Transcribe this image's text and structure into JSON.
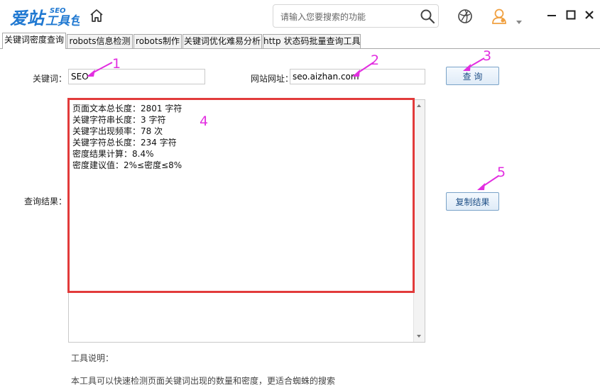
{
  "app": {
    "logo_text": "爱站",
    "logo_sub": "工具包",
    "logo_seo": "SEO",
    "search_placeholder": "请输入您要搜索的功能"
  },
  "tabs": [
    {
      "label": "关键词密度查询",
      "active": true
    },
    {
      "label": "robots信息检测",
      "active": false
    },
    {
      "label": "robots制作",
      "active": false
    },
    {
      "label": "关键词优化难易分析",
      "active": false
    },
    {
      "label": "http 状态码批量查询工具",
      "active": false
    }
  ],
  "form": {
    "keyword_label": "关键词：",
    "keyword_value": "SEO",
    "url_label": "网站网址：",
    "url_value": "seo.aizhan.com",
    "query_button": "查 询",
    "result_label": "查询结果：",
    "copy_button": "复制结果"
  },
  "results": [
    "页面文本总长度：2801 字符",
    "关键字符串长度：3 字符",
    "关键字出现频率：78 次",
    "关键字符总长度：234 字符",
    "密度结果计算：8.4%",
    "密度建议值：2%≤密度≤8%"
  ],
  "annotations": [
    "1",
    "2",
    "3",
    "4",
    "5"
  ],
  "notes": {
    "title": "工具说明：",
    "description": "本工具可以快速检测页面关键词出现的数量和密度，更适合蜘蛛的搜索"
  },
  "colors": {
    "brand_blue": "#1f78d1",
    "annotation_magenta": "#e22ee0",
    "highlight_red": "#e23b3b",
    "user_orange": "#f0a040"
  }
}
